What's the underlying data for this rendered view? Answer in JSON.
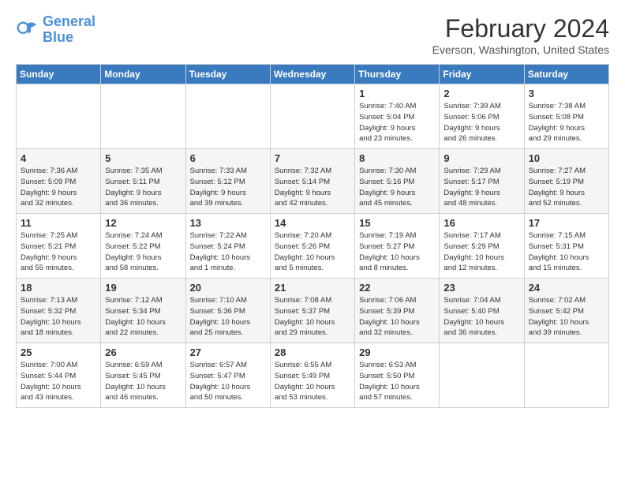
{
  "logo": {
    "text1": "General",
    "text2": "Blue"
  },
  "title": "February 2024",
  "subtitle": "Everson, Washington, United States",
  "headers": [
    "Sunday",
    "Monday",
    "Tuesday",
    "Wednesday",
    "Thursday",
    "Friday",
    "Saturday"
  ],
  "weeks": [
    [
      {
        "day": "",
        "info": ""
      },
      {
        "day": "",
        "info": ""
      },
      {
        "day": "",
        "info": ""
      },
      {
        "day": "",
        "info": ""
      },
      {
        "day": "1",
        "info": "Sunrise: 7:40 AM\nSunset: 5:04 PM\nDaylight: 9 hours\nand 23 minutes."
      },
      {
        "day": "2",
        "info": "Sunrise: 7:39 AM\nSunset: 5:06 PM\nDaylight: 9 hours\nand 26 minutes."
      },
      {
        "day": "3",
        "info": "Sunrise: 7:38 AM\nSunset: 5:08 PM\nDaylight: 9 hours\nand 29 minutes."
      }
    ],
    [
      {
        "day": "4",
        "info": "Sunrise: 7:36 AM\nSunset: 5:09 PM\nDaylight: 9 hours\nand 32 minutes."
      },
      {
        "day": "5",
        "info": "Sunrise: 7:35 AM\nSunset: 5:11 PM\nDaylight: 9 hours\nand 36 minutes."
      },
      {
        "day": "6",
        "info": "Sunrise: 7:33 AM\nSunset: 5:12 PM\nDaylight: 9 hours\nand 39 minutes."
      },
      {
        "day": "7",
        "info": "Sunrise: 7:32 AM\nSunset: 5:14 PM\nDaylight: 9 hours\nand 42 minutes."
      },
      {
        "day": "8",
        "info": "Sunrise: 7:30 AM\nSunset: 5:16 PM\nDaylight: 9 hours\nand 45 minutes."
      },
      {
        "day": "9",
        "info": "Sunrise: 7:29 AM\nSunset: 5:17 PM\nDaylight: 9 hours\nand 48 minutes."
      },
      {
        "day": "10",
        "info": "Sunrise: 7:27 AM\nSunset: 5:19 PM\nDaylight: 9 hours\nand 52 minutes."
      }
    ],
    [
      {
        "day": "11",
        "info": "Sunrise: 7:25 AM\nSunset: 5:21 PM\nDaylight: 9 hours\nand 55 minutes."
      },
      {
        "day": "12",
        "info": "Sunrise: 7:24 AM\nSunset: 5:22 PM\nDaylight: 9 hours\nand 58 minutes."
      },
      {
        "day": "13",
        "info": "Sunrise: 7:22 AM\nSunset: 5:24 PM\nDaylight: 10 hours\nand 1 minute."
      },
      {
        "day": "14",
        "info": "Sunrise: 7:20 AM\nSunset: 5:26 PM\nDaylight: 10 hours\nand 5 minutes."
      },
      {
        "day": "15",
        "info": "Sunrise: 7:19 AM\nSunset: 5:27 PM\nDaylight: 10 hours\nand 8 minutes."
      },
      {
        "day": "16",
        "info": "Sunrise: 7:17 AM\nSunset: 5:29 PM\nDaylight: 10 hours\nand 12 minutes."
      },
      {
        "day": "17",
        "info": "Sunrise: 7:15 AM\nSunset: 5:31 PM\nDaylight: 10 hours\nand 15 minutes."
      }
    ],
    [
      {
        "day": "18",
        "info": "Sunrise: 7:13 AM\nSunset: 5:32 PM\nDaylight: 10 hours\nand 18 minutes."
      },
      {
        "day": "19",
        "info": "Sunrise: 7:12 AM\nSunset: 5:34 PM\nDaylight: 10 hours\nand 22 minutes."
      },
      {
        "day": "20",
        "info": "Sunrise: 7:10 AM\nSunset: 5:36 PM\nDaylight: 10 hours\nand 25 minutes."
      },
      {
        "day": "21",
        "info": "Sunrise: 7:08 AM\nSunset: 5:37 PM\nDaylight: 10 hours\nand 29 minutes."
      },
      {
        "day": "22",
        "info": "Sunrise: 7:06 AM\nSunset: 5:39 PM\nDaylight: 10 hours\nand 32 minutes."
      },
      {
        "day": "23",
        "info": "Sunrise: 7:04 AM\nSunset: 5:40 PM\nDaylight: 10 hours\nand 36 minutes."
      },
      {
        "day": "24",
        "info": "Sunrise: 7:02 AM\nSunset: 5:42 PM\nDaylight: 10 hours\nand 39 minutes."
      }
    ],
    [
      {
        "day": "25",
        "info": "Sunrise: 7:00 AM\nSunset: 5:44 PM\nDaylight: 10 hours\nand 43 minutes."
      },
      {
        "day": "26",
        "info": "Sunrise: 6:59 AM\nSunset: 5:45 PM\nDaylight: 10 hours\nand 46 minutes."
      },
      {
        "day": "27",
        "info": "Sunrise: 6:57 AM\nSunset: 5:47 PM\nDaylight: 10 hours\nand 50 minutes."
      },
      {
        "day": "28",
        "info": "Sunrise: 6:55 AM\nSunset: 5:49 PM\nDaylight: 10 hours\nand 53 minutes."
      },
      {
        "day": "29",
        "info": "Sunrise: 6:53 AM\nSunset: 5:50 PM\nDaylight: 10 hours\nand 57 minutes."
      },
      {
        "day": "",
        "info": ""
      },
      {
        "day": "",
        "info": ""
      }
    ]
  ]
}
